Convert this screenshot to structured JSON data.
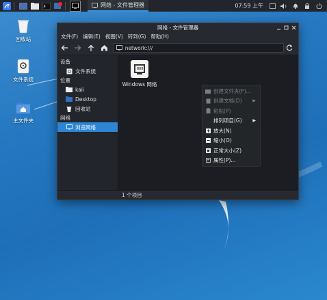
{
  "panel": {
    "task_title": "网络 - 文件管理器",
    "clock": "07:59 上午"
  },
  "desktop": {
    "icons": [
      {
        "label": "回收站"
      },
      {
        "label": "文件系统"
      },
      {
        "label": "主文件夹"
      }
    ]
  },
  "window": {
    "title": "网络 - 文件管理器",
    "menu": [
      "文件(F)",
      "编辑(E)",
      "视图(V)",
      "转到(G)",
      "帮助(H)"
    ],
    "location": "network:///",
    "sidebar": {
      "sections": [
        {
          "header": "设备",
          "items": [
            "文件系统"
          ]
        },
        {
          "header": "位置",
          "items": [
            "kali",
            "Desktop",
            "回收站"
          ]
        },
        {
          "header": "网络",
          "items": [
            "浏览网络"
          ]
        }
      ],
      "active": "浏览网络"
    },
    "files": [
      {
        "label": "Windows 网络"
      }
    ],
    "status": "1 个项目"
  },
  "context_menu": {
    "items": [
      {
        "label": "创建文件夹(F)...",
        "disabled": true
      },
      {
        "label": "创建文档(D)",
        "disabled": true,
        "submenu": true
      },
      {
        "label": "粘贴(P)",
        "disabled": true
      },
      {
        "label": "排列项目(G)",
        "disabled": false,
        "submenu": true
      },
      {
        "label": "放大(N)",
        "disabled": false
      },
      {
        "label": "缩小(O)",
        "disabled": false
      },
      {
        "label": "正常大小(Z)",
        "disabled": false
      },
      {
        "label": "属性(P)...",
        "disabled": false
      }
    ]
  },
  "colors": {
    "accent": "#2e85d4",
    "panel": "#22252b",
    "window_bg": "#1f2228"
  }
}
